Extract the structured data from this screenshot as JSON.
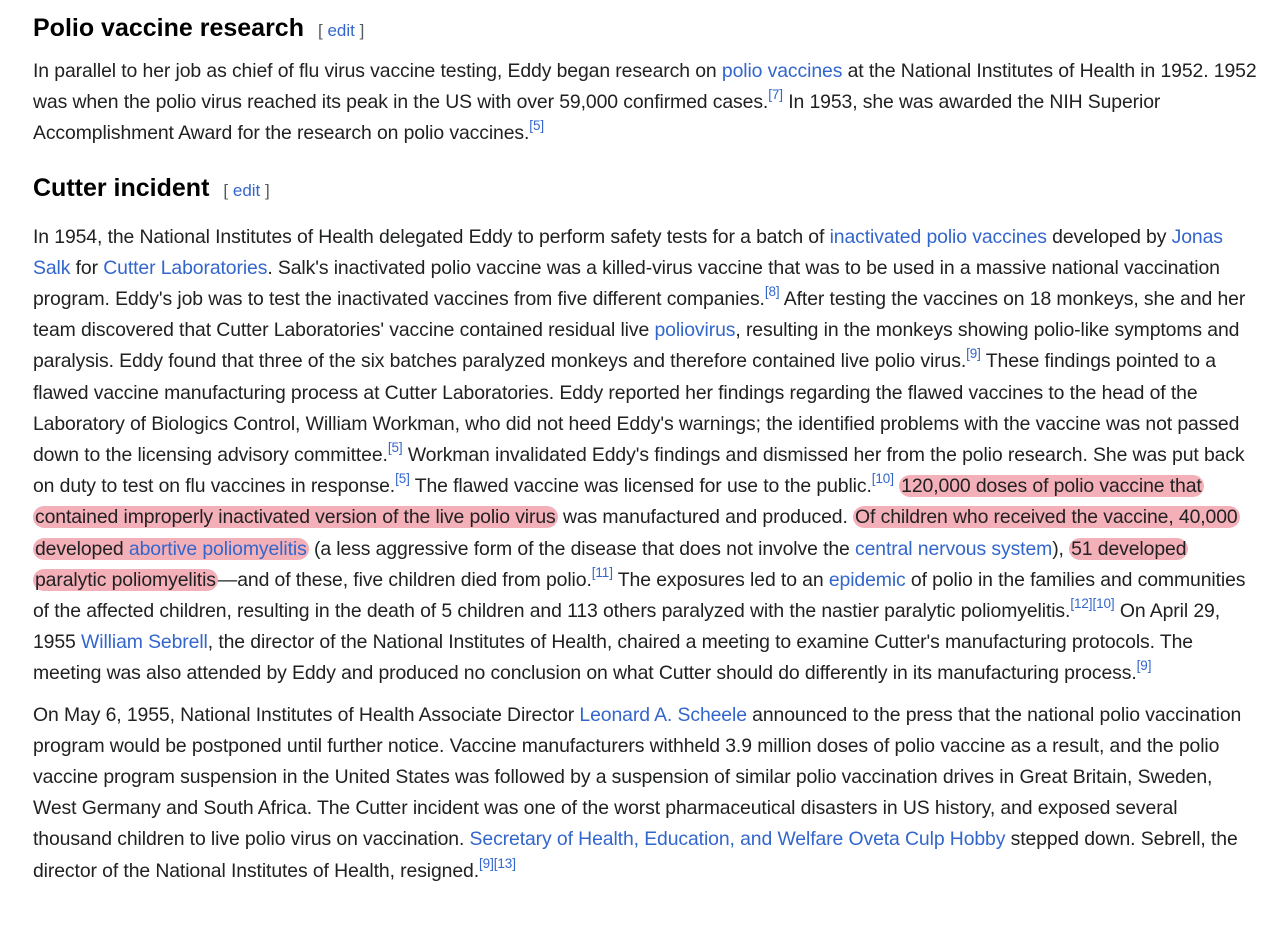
{
  "section1": {
    "title": "Polio vaccine research",
    "edit": "edit",
    "p1_t1": "In parallel to her job as chief of flu virus vaccine testing, Eddy began research on ",
    "p1_l1": "polio vaccines",
    "p1_t2": " at the National Institutes of Health in 1952. 1952 was when the polio virus reached its peak in the US with over 59,000 confirmed cases.",
    "p1_c1": "[7]",
    "p1_t3": " In 1953, she was awarded the NIH Superior Accomplishment Award for the research on polio vaccines.",
    "p1_c2": "[5]"
  },
  "section2": {
    "title": "Cutter incident",
    "edit": "edit",
    "p2_t1": "In 1954, the National Institutes of Health delegated Eddy to perform safety tests for a batch of ",
    "p2_l1": "inactivated polio vaccines",
    "p2_t2": " developed by ",
    "p2_l2": "Jonas Salk",
    "p2_t3": " for ",
    "p2_l3": "Cutter Laboratories",
    "p2_t4": ". Salk's inactivated polio vaccine was a killed-virus vaccine that was to be used in a massive national vaccination program. Eddy's job was to test the inactivated vaccines from five different companies.",
    "p2_c1": "[8]",
    "p2_t5": " After testing the vaccines on 18 monkeys, she and her team discovered that Cutter Laboratories' vaccine contained residual live ",
    "p2_l4": "poliovirus",
    "p2_t6": ", resulting in the monkeys showing polio-like symptoms and paralysis. Eddy found that three of the six batches paralyzed monkeys and therefore contained live polio virus.",
    "p2_c2": "[9]",
    "p2_t7": " These findings pointed to a flawed vaccine manufacturing process at Cutter Laboratories. Eddy reported her findings regarding the flawed vaccines to the head of the Laboratory of Biologics Control, William Workman, who did not heed Eddy's warnings; the identified problems with the vaccine was not passed down to the licensing advisory committee.",
    "p2_c3": "[5]",
    "p2_t8": " Workman invalidated Eddy's findings and dismissed her from the polio research. She was put back on duty to test on flu vaccines in response.",
    "p2_c4": "[5]",
    "p2_t9": " The flawed vaccine was licensed for use to the public.",
    "p2_c5": "[10]",
    "p2_h1": "120,000 doses of polio vaccine that contained improperly inactivated version of the live polio virus",
    "p2_t10": " was manufactured and produced. ",
    "p2_h2a": "Of children who received the vaccine, 40,000 developed ",
    "p2_h2l": "abortive poliomyelitis",
    "p2_t11": " (a less aggressive form of the disease that does not involve the ",
    "p2_l5": "central nervous system",
    "p2_t12": "), ",
    "p2_h3": "51 developed paralytic poliomyelitis",
    "p2_t13": "—and of these, five children died from polio.",
    "p2_c6": "[11]",
    "p2_t14": " The exposures led to an ",
    "p2_l6": "epidemic",
    "p2_t15": " of polio in the families and communities of the affected children, resulting in the death of 5 children and 113 others paralyzed with the nastier paralytic poliomyelitis.",
    "p2_c7": "[12]",
    "p2_c8": "[10]",
    "p2_t16": " On April 29, 1955 ",
    "p2_l7": "William Sebrell",
    "p2_t17": ", the director of the National Institutes of Health, chaired a meeting to examine Cutter's manufacturing protocols. The meeting was also attended by Eddy and produced no conclusion on what Cutter should do differently in its manufacturing process.",
    "p2_c9": "[9]",
    "p3_t1": "On May 6, 1955, National Institutes of Health Associate Director ",
    "p3_l1": "Leonard A. Scheele",
    "p3_t2": " announced to the press that the national polio vaccination program would be postponed until further notice. Vaccine manufacturers withheld 3.9 million doses of polio vaccine as a result, and the polio vaccine program suspension in the United States was followed by a suspension of similar polio vaccination drives in Great Britain, Sweden, West Germany and South Africa. The Cutter incident was one of the worst pharmaceutical disasters in US history, and exposed several thousand children to live polio virus on vaccination. ",
    "p3_l2": "Secretary of Health, Education, and Welfare Oveta Culp Hobby",
    "p3_t3": " stepped down. Sebrell, the director of the National Institutes of Health, resigned.",
    "p3_c1": "[9]",
    "p3_c2": "[13]"
  },
  "colors": {
    "link": "#3366cc",
    "text": "#202122",
    "highlight": "#e65064"
  }
}
